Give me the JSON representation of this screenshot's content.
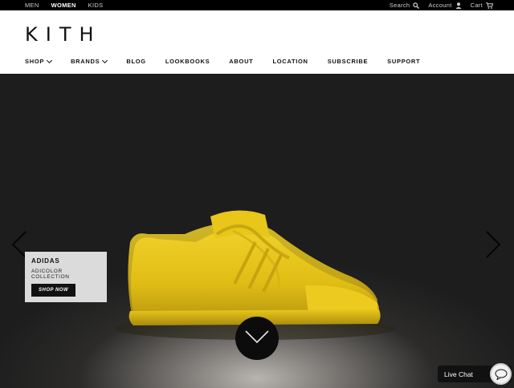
{
  "topbar": {
    "gender_tabs": [
      {
        "label": "MEN"
      },
      {
        "label": "WOMEN",
        "active": true
      },
      {
        "label": "KIDS"
      }
    ],
    "search_label": "Search",
    "account_label": "Account",
    "cart_label": "Cart"
  },
  "header": {
    "logo": "KITH",
    "nav": [
      {
        "label": "SHOP",
        "dropdown": true
      },
      {
        "label": "BRANDS",
        "dropdown": true
      },
      {
        "label": "BLOG"
      },
      {
        "label": "LOOKBOOKS"
      },
      {
        "label": "ABOUT"
      },
      {
        "label": "LOCATION"
      },
      {
        "label": "SUBSCRIBE"
      },
      {
        "label": "SUPPORT"
      }
    ]
  },
  "hero": {
    "brand": "ADIDAS",
    "collection": "ADICOLOR COLLECTION",
    "cta": "SHOP NOW",
    "colors": {
      "shoe": "#e5c418",
      "shoe_shadow": "#b8950c",
      "backdrop": "#1d1d1d"
    }
  },
  "chat": {
    "label": "Live Chat"
  },
  "icons": [
    "search-icon",
    "account-icon",
    "cart-icon",
    "chevron-left-icon",
    "chevron-right-icon",
    "chevron-down-icon",
    "chat-icon"
  ]
}
